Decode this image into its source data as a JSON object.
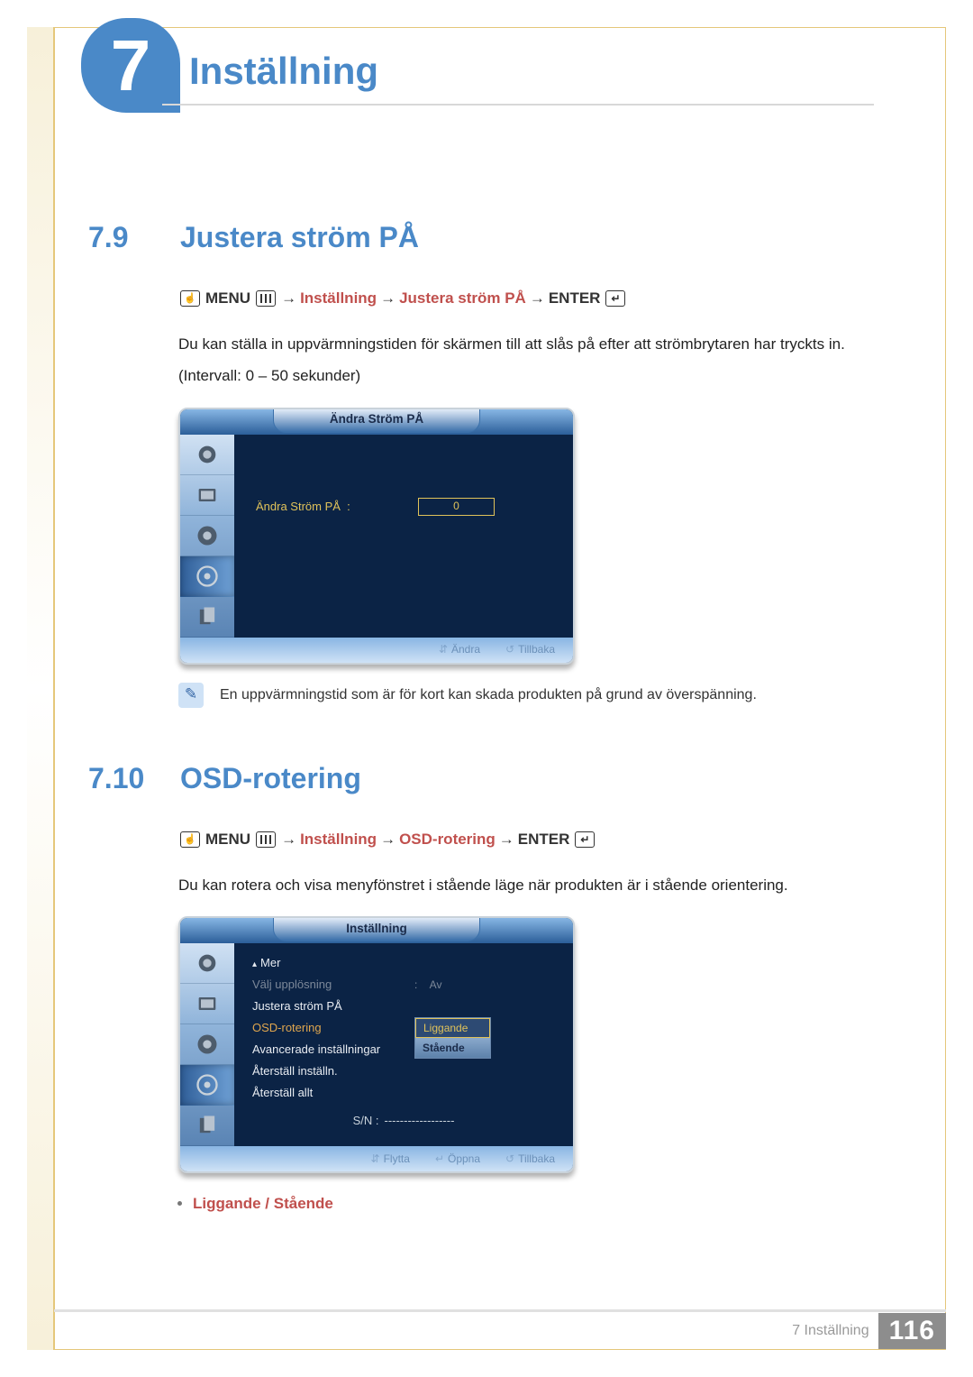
{
  "chapter": {
    "number": "7",
    "title": "Inställning"
  },
  "section1": {
    "number": "7.9",
    "title": "Justera ström PÅ",
    "nav": {
      "menu": "MENU",
      "arrow": "→",
      "p1": "Inställning",
      "p2": "Justera ström PÅ",
      "enter": "ENTER"
    },
    "body1": "Du kan ställa in uppvärmningstiden för skärmen till att slås på efter att strömbrytaren har tryckts in.",
    "body2": "(Intervall: 0 – 50 sekunder)",
    "osd": {
      "title": "Ändra Ström PÅ",
      "row_label": "Ändra Ström PÅ",
      "row_value": "0",
      "footer": {
        "change": "Ändra",
        "back": "Tillbaka"
      }
    },
    "note": "En uppvärmningstid som är för kort kan skada produkten på grund av överspänning."
  },
  "section2": {
    "number": "7.10",
    "title": "OSD-rotering",
    "nav": {
      "menu": "MENU",
      "arrow": "→",
      "p1": "Inställning",
      "p2": "OSD-rotering",
      "enter": "ENTER"
    },
    "body1": "Du kan rotera och visa menyfönstret i stående läge när produkten är i stående orientering.",
    "osd": {
      "title": "Inställning",
      "more": "Mer",
      "rows": {
        "r1_label": "Välj upplösning",
        "r1_val": "Av",
        "r2_label": "Justera ström PÅ",
        "r3_label": "OSD-rotering",
        "r3_opt1": "Liggande",
        "r3_opt2": "Stående",
        "r4_label": "Avancerade inställningar",
        "r5_label": "Återställ inställn.",
        "r6_label": "Återställ allt",
        "sn_label": "S/N :",
        "sn_val": "------------------"
      },
      "footer": {
        "move": "Flytta",
        "open": "Öppna",
        "back": "Tillbaka"
      }
    },
    "bullet": {
      "a": "Liggande",
      "sep": " / ",
      "b": "Stående"
    }
  },
  "footer": {
    "text": "7 Inställning",
    "page": "116"
  }
}
